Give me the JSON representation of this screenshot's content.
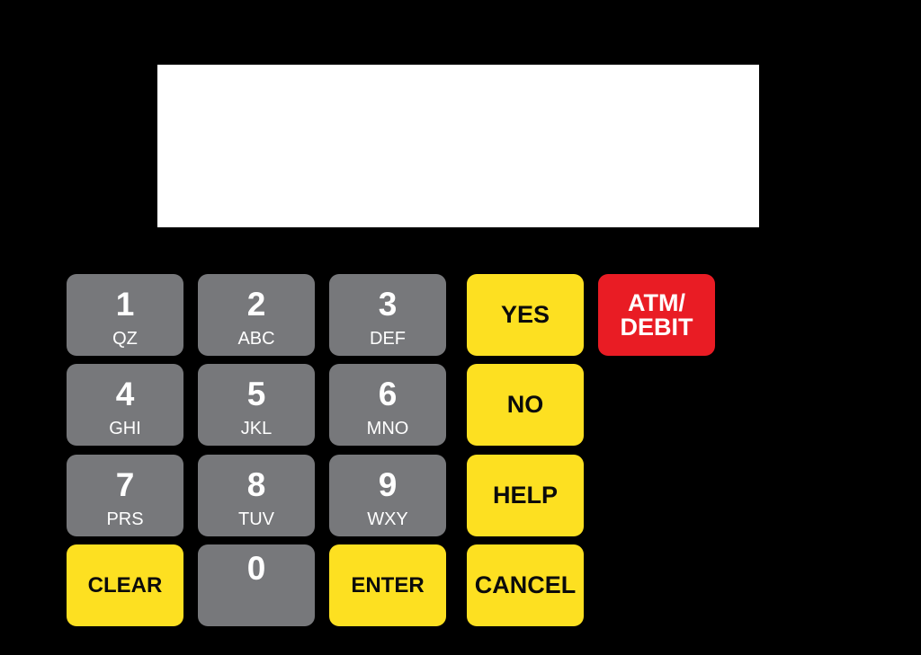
{
  "display": {
    "text": ""
  },
  "colors": {
    "background": "#000000",
    "display": "#ffffff",
    "numeric_key": "#77787b",
    "function_key": "#fde021",
    "atm_key": "#e91c24"
  },
  "keypad": {
    "numeric": [
      {
        "digit": "1",
        "letters": "QZ"
      },
      {
        "digit": "2",
        "letters": "ABC"
      },
      {
        "digit": "3",
        "letters": "DEF"
      },
      {
        "digit": "4",
        "letters": "GHI"
      },
      {
        "digit": "5",
        "letters": "JKL"
      },
      {
        "digit": "6",
        "letters": "MNO"
      },
      {
        "digit": "7",
        "letters": "PRS"
      },
      {
        "digit": "8",
        "letters": "TUV"
      },
      {
        "digit": "9",
        "letters": "WXY"
      },
      {
        "digit": "0",
        "letters": ""
      }
    ],
    "clear": "CLEAR",
    "enter": "ENTER",
    "yes": "YES",
    "no": "NO",
    "help": "HELP",
    "cancel": "CANCEL",
    "atm_debit": "ATM/\nDEBIT"
  }
}
